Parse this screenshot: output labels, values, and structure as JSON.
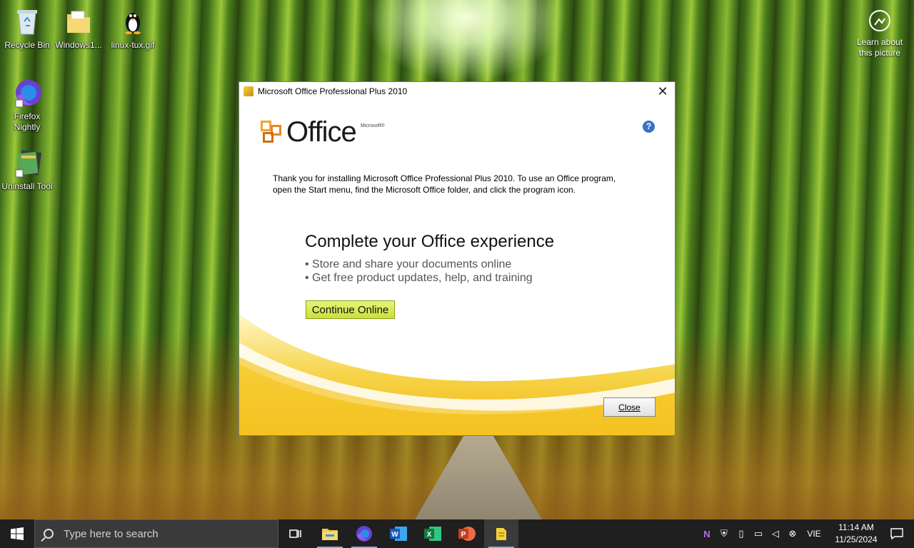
{
  "desktop": {
    "icons": [
      {
        "label": "Recycle Bin",
        "icon": "recycle-bin-icon"
      },
      {
        "label": "Windows1...",
        "icon": "folder-icon"
      },
      {
        "label": "linux-tux.gif",
        "icon": "tux-penguin-icon"
      },
      {
        "label": "Firefox Nightly",
        "icon": "firefox-nightly-icon"
      },
      {
        "label": "Uninstall Tool",
        "icon": "uninstall-tool-icon"
      }
    ],
    "learn_about": "Learn about this picture"
  },
  "dialog": {
    "title": "Microsoft Office Professional Plus 2010",
    "logo_word": "Office",
    "logo_small": "Microsoft®",
    "help_symbol": "?",
    "intro_text": "Thank you for installing Microsoft Office Professional Plus 2010. To use an Office program, open the Start menu, find the Microsoft Office folder, and click the program icon.",
    "heading": "Complete your Office experience",
    "bullets": [
      "• Store and share your documents online",
      "• Get free product updates, help, and training"
    ],
    "continue_button": "Continue Online",
    "close_button": "Close",
    "colors": {
      "accent_yellow": "#f2c21b",
      "button_green": "#d6ea4f",
      "office_orange": "#e58a1a"
    }
  },
  "taskbar": {
    "search_placeholder": "Type here to search",
    "apps": [
      {
        "name": "task-view-icon"
      },
      {
        "name": "file-explorer-icon"
      },
      {
        "name": "firefox-icon"
      },
      {
        "name": "word-icon"
      },
      {
        "name": "excel-icon"
      },
      {
        "name": "powerpoint-icon"
      },
      {
        "name": "office-setup-icon"
      }
    ],
    "tray": {
      "language": "VIE",
      "time": "11:14 AM",
      "date": "11/25/2024"
    }
  }
}
